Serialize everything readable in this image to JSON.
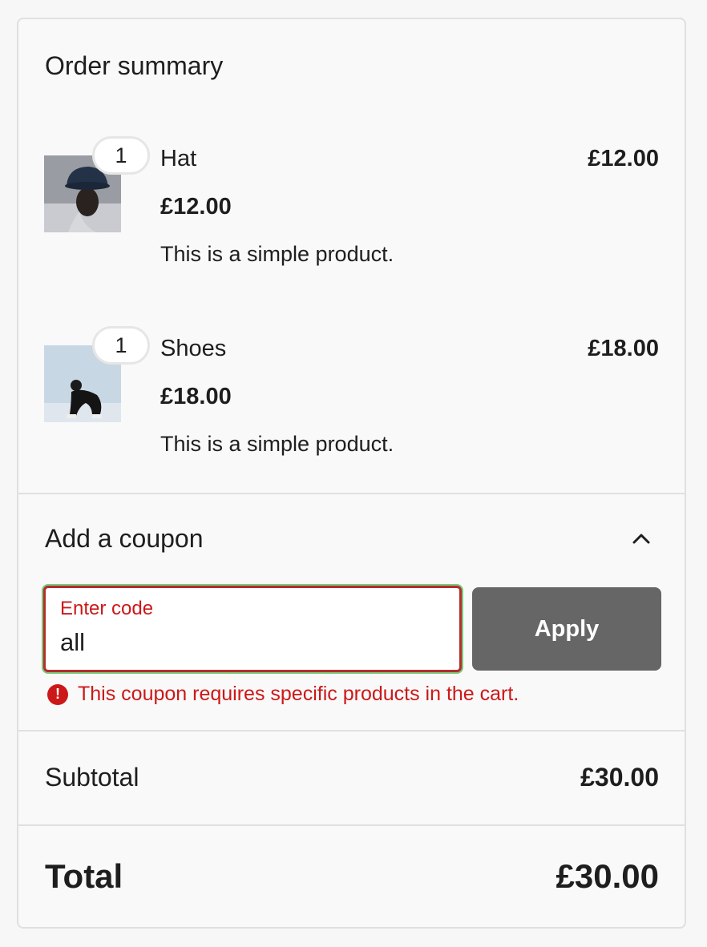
{
  "summary": {
    "title": "Order summary",
    "items": [
      {
        "qty": "1",
        "name": "Hat",
        "price_line": "£12.00",
        "price": "£12.00",
        "description": "This is a simple product."
      },
      {
        "qty": "1",
        "name": "Shoes",
        "price_line": "£18.00",
        "price": "£18.00",
        "description": "This is a simple product."
      }
    ]
  },
  "coupon": {
    "heading": "Add a coupon",
    "field_label": "Enter code",
    "field_value": "all",
    "apply_label": "Apply",
    "error_message": "This coupon requires specific products in the cart."
  },
  "totals": {
    "subtotal_label": "Subtotal",
    "subtotal_value": "£30.00",
    "total_label": "Total",
    "total_value": "£30.00"
  },
  "colors": {
    "error": "#cc1818",
    "apply_button": "#666666"
  }
}
